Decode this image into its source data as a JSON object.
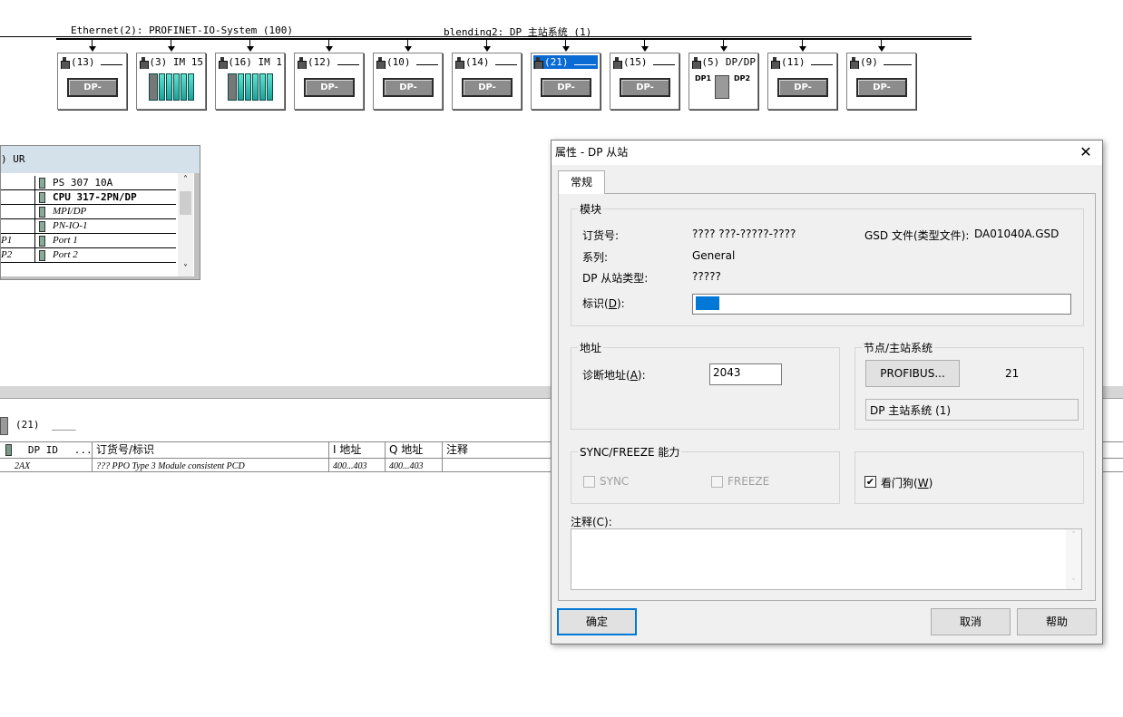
{
  "network": {
    "ethernet_label": "Ethernet(2): PROFINET-IO-System (100)",
    "dp_label": "blending2: DP 主站系统 (1)"
  },
  "slaves": [
    {
      "num": "(13)",
      "kind": "dp-norm",
      "box_label": "DP-NORM"
    },
    {
      "num": "(3) IM 15",
      "kind": "rack"
    },
    {
      "num": "(16) IM 1",
      "kind": "rack"
    },
    {
      "num": "(12)",
      "kind": "dp-norm",
      "box_label": "DP-NORM"
    },
    {
      "num": "(10)",
      "kind": "dp-norm",
      "box_label": "DP-NORM"
    },
    {
      "num": "(14)",
      "kind": "dp-norm",
      "box_label": "DP-NORM"
    },
    {
      "num": "(21)",
      "kind": "dp-norm",
      "box_label": "DP-NORM",
      "selected": true
    },
    {
      "num": "(15)",
      "kind": "dp-norm",
      "box_label": "DP-NORM"
    },
    {
      "num": "(5) DP/DP",
      "kind": "coupler",
      "dp1": "DP1",
      "dp2": "DP2"
    },
    {
      "num": "(11)",
      "kind": "dp-norm",
      "box_label": "DP-NORM"
    },
    {
      "num": "(9)",
      "kind": "dp-norm",
      "box_label": "DP-NORM"
    }
  ],
  "rack": {
    "title": ") UR",
    "rows": [
      {
        "slot": "",
        "module": "PS 307 10A",
        "style": "normal"
      },
      {
        "slot": "",
        "module": "CPU 317-2PN/DP",
        "style": "bold"
      },
      {
        "slot": "",
        "module": "MPI/DP",
        "style": "italic"
      },
      {
        "slot": "",
        "module": "PN-IO-1",
        "style": "italic"
      },
      {
        "slot": "P1",
        "module": "Port 1",
        "style": "italic"
      },
      {
        "slot": "P2",
        "module": "Port 2",
        "style": "italic"
      }
    ]
  },
  "detail": {
    "station": "(21)",
    "suffix": "____",
    "headers": [
      "DP ID",
      "...",
      "订货号/标识",
      "I 地址",
      "Q 地址",
      "注释"
    ],
    "row": {
      "dp_id": "2AX",
      "order": "??? PPO Type 3 Module consistent PCD",
      "i_addr": "400...403",
      "q_addr": "400...403"
    }
  },
  "dialog": {
    "title": "属性 - DP 从站",
    "close": "✕",
    "tab": "常规",
    "module_group": "模块",
    "order_no_label": "订货号:",
    "order_no": "???? ???-?????-????",
    "gsd_label": "GSD 文件(类型文件):",
    "gsd_value": "DA01040A.GSD",
    "family_label": "系列:",
    "family_value": "General",
    "slave_type_label": "DP 从站类型:",
    "slave_type_value": "?????",
    "ident_label_pre": "标识(",
    "ident_label_key": "D",
    "ident_label_post": "):",
    "address_group": "地址",
    "diag_label_pre": "诊断地址(",
    "diag_label_key": "A",
    "diag_label_post": "):",
    "diag_value": "2043",
    "node_group": "节点/主站系统",
    "profibus_button": "PROFIBUS...",
    "node_number": "21",
    "master_system": "DP 主站系统 (1)",
    "sync_group": "SYNC/FREEZE 能力",
    "sync_label": "SYNC",
    "freeze_label": "FREEZE",
    "watchdog_label_pre": "看门狗(",
    "watchdog_label_key": "W",
    "watchdog_label_post": ")",
    "watchdog_checked": "✔",
    "comment_label": "注释(C):",
    "ok_button": "确定",
    "cancel_button": "取消",
    "help_button": "帮助"
  },
  "colors": {
    "selection": "#0b6bd4",
    "accent": "#0078d7"
  }
}
